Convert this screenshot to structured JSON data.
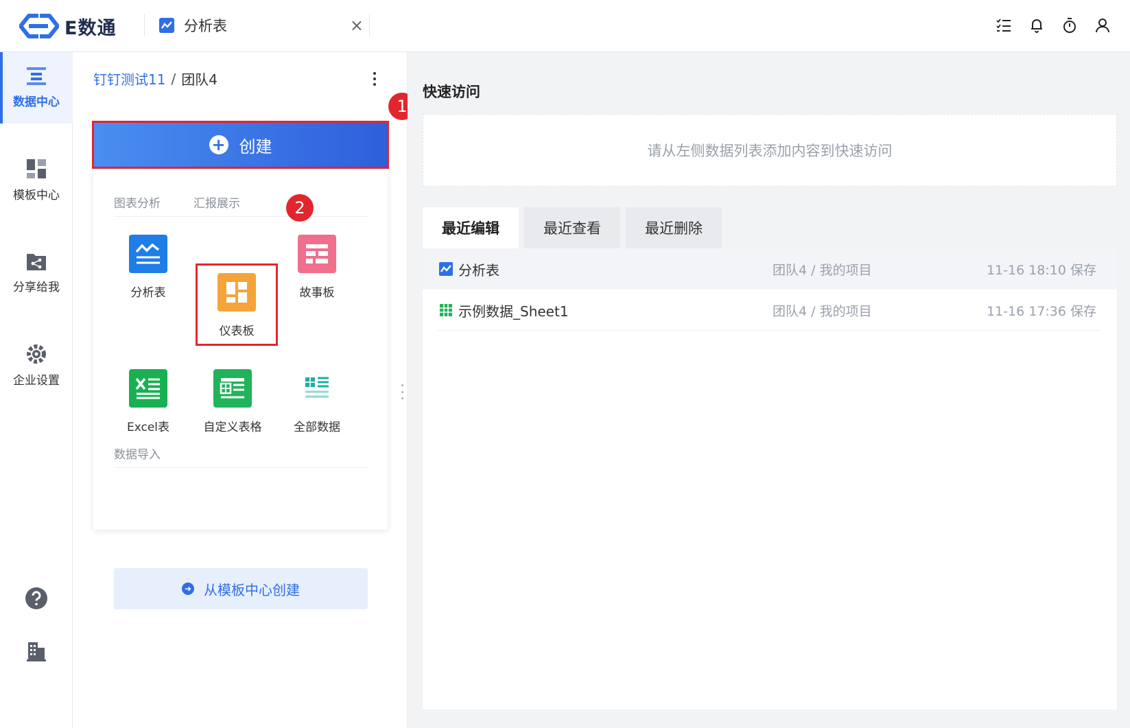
{
  "app": {
    "name": "E数通",
    "open_tab": {
      "label": "分析表",
      "close": "×"
    }
  },
  "nav": {
    "items": [
      {
        "label": "数据中心",
        "icon": "data-center-icon",
        "active": true
      },
      {
        "label": "模板中心",
        "icon": "template-center-icon",
        "active": false
      },
      {
        "label": "分享给我",
        "icon": "share-icon",
        "active": false
      },
      {
        "label": "企业设置",
        "icon": "settings-icon",
        "active": false
      }
    ],
    "help_icon": "help-icon",
    "org_icon": "building-icon"
  },
  "breadcrumb": {
    "parent": "钉钉测试11",
    "separator": "/",
    "current": "团队4"
  },
  "create": {
    "button_label": "创建",
    "sections": {
      "tab1": "图表分析",
      "tab2": "汇报展示",
      "import_title": "数据导入"
    },
    "items": [
      {
        "label": "分析表",
        "color": "#1e7de6"
      },
      {
        "label": "仪表板",
        "color": "#f5a43a"
      },
      {
        "label": "故事板",
        "color": "#ef6f8d"
      },
      {
        "label": "Excel表",
        "color": "#18b052"
      },
      {
        "label": "自定义表格",
        "color": "#21b35a"
      },
      {
        "label": "全部数据",
        "color": "#1ab0a3"
      }
    ],
    "from_template": "从模板中心创建"
  },
  "annotations": {
    "step1": "1",
    "step2": "2"
  },
  "quick_access": {
    "title": "快速访问",
    "empty_text": "请从左侧数据列表添加内容到快速访问"
  },
  "recent": {
    "tabs": [
      "最近编辑",
      "最近查看",
      "最近删除"
    ],
    "rows": [
      {
        "name": "分析表",
        "path": "团队4 / 我的项目",
        "time": "11-16 18:10 保存",
        "icon": "analysis-table-icon"
      },
      {
        "name": "示例数据_Sheet1",
        "path": "团队4 / 我的项目",
        "time": "11-16 17:36 保存",
        "icon": "spreadsheet-icon"
      }
    ]
  },
  "colors": {
    "accent": "#2f6fe6",
    "highlight": "#e3262e"
  }
}
